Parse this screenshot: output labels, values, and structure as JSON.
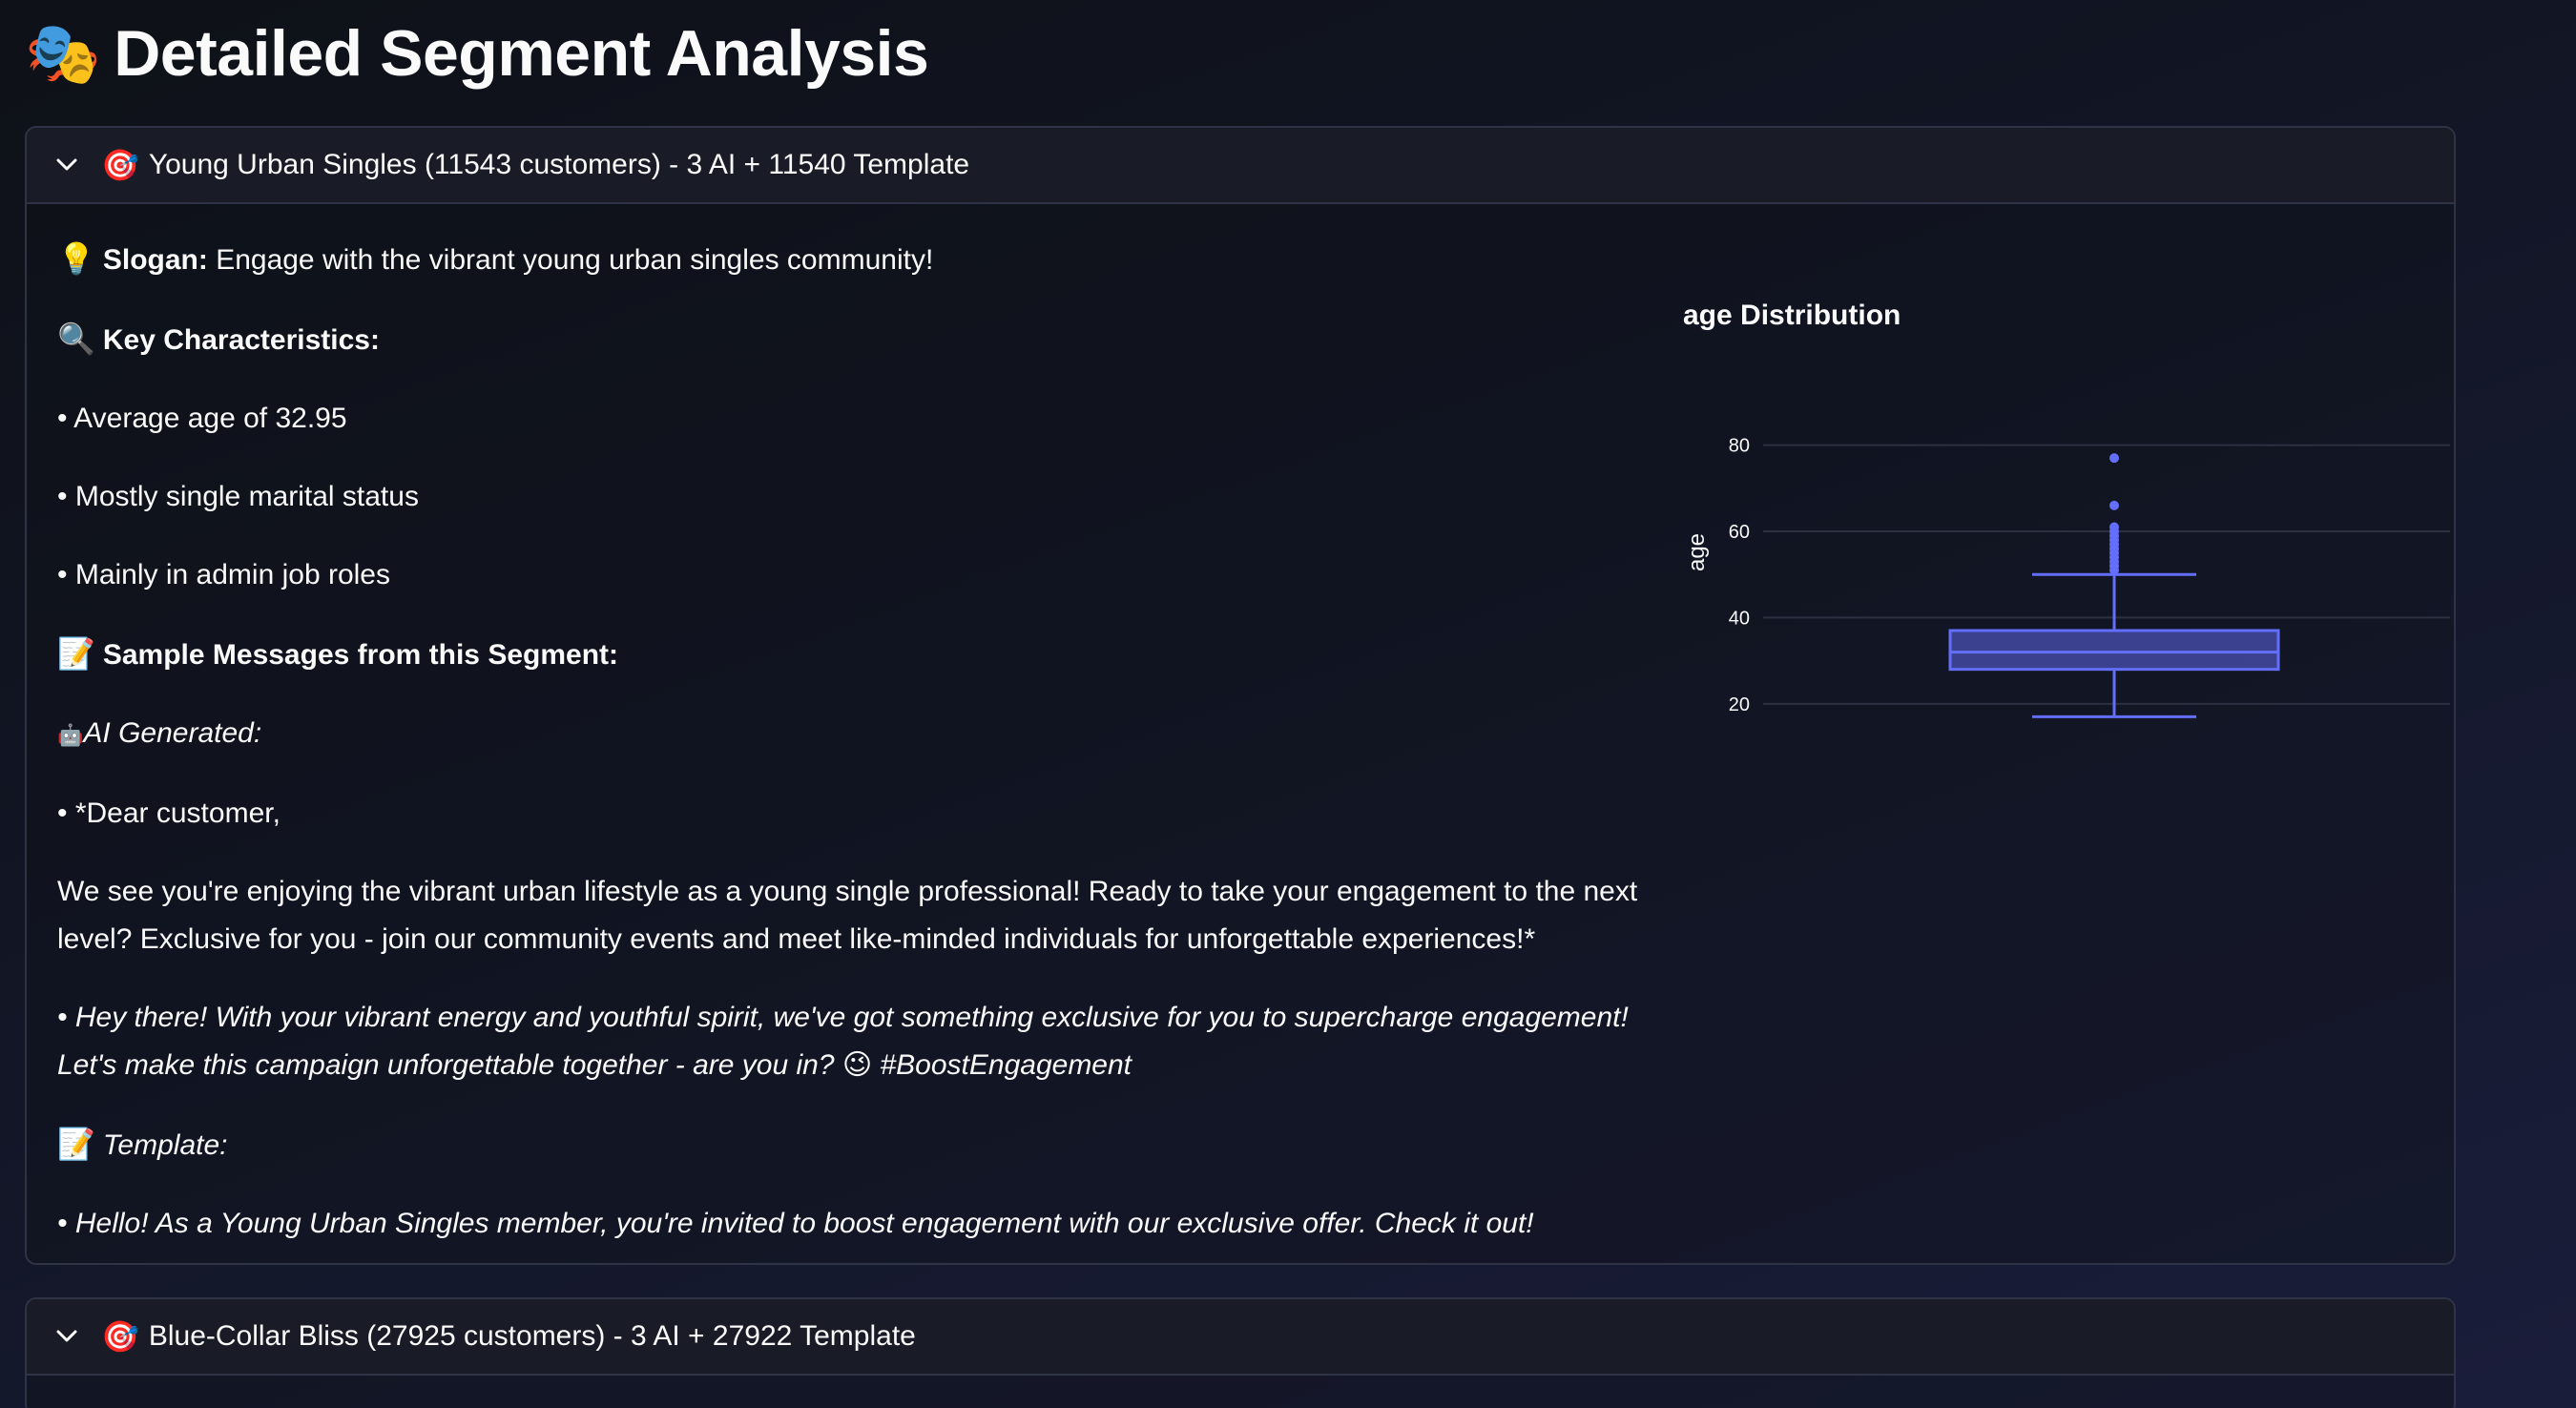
{
  "page": {
    "title": "Detailed Segment Analysis",
    "title_icon": "🎭"
  },
  "segments": [
    {
      "header_icon": "🎯",
      "header": "Young Urban Singles (11543 customers) - 3 AI + 11540 Template",
      "expanded": true,
      "slogan_icon": "💡",
      "slogan_label": "Slogan:",
      "slogan_text": "Engage with the vibrant young urban singles community!",
      "characteristics_icon": "🔍",
      "characteristics_label": "Key Characteristics:",
      "characteristics": [
        "• Average age of 32.95",
        "• Mostly single marital status",
        "• Mainly in admin job roles"
      ],
      "samples_icon": "📝",
      "samples_label": "Sample Messages from this Segment:",
      "ai_icon": "🤖",
      "ai_label": "AI Generated:",
      "ai_msg1_line1": "• *Dear customer,",
      "ai_msg1_body": "We see you're enjoying the vibrant urban lifestyle as a young single professional! Ready to take your engagement to the next level? Exclusive for you - join our community events and meet like-minded individuals for unforgettable experiences!*",
      "ai_msg2": "• Hey there! With your vibrant energy and youthful spirit, we've got something exclusive for you to supercharge engagement! Let's make this campaign unforgettable together - are you in? 😉 #BoostEngagement",
      "template_icon": "📝",
      "template_label": "Template:",
      "template_msg": "• Hello! As a Young Urban Singles member, you're invited to boost engagement with our exclusive offer. Check it out!"
    },
    {
      "header_icon": "🎯",
      "header": "Blue-Collar Bliss (27925 customers) - 3 AI + 27922 Template",
      "expanded": false
    }
  ],
  "chart_data": {
    "type": "box",
    "title": "age Distribution",
    "ylabel": "age",
    "xlabel": "",
    "ylim": [
      12,
      85
    ],
    "yticks": [
      20,
      40,
      60,
      80
    ],
    "box": {
      "lowerfence": 17,
      "q1": 28,
      "median": 32,
      "q3": 37,
      "upperfence": 50,
      "outliers": [
        51,
        52,
        53,
        54,
        55,
        56,
        57,
        58,
        59,
        60,
        61,
        66,
        77
      ]
    },
    "color": "#636efa",
    "grid": true
  }
}
